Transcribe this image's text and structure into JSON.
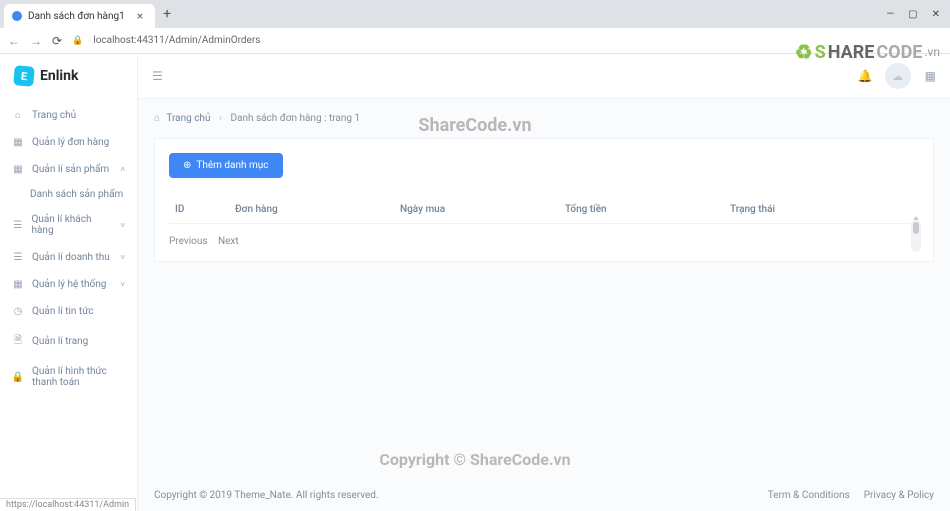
{
  "browser": {
    "tab_title": "Danh sách đơn hàng1",
    "url": "localhost:44311/Admin/AdminOrders",
    "status_link": "https://localhost:44311/Admin"
  },
  "watermarks": {
    "top_brand": "SHARECODE.vn",
    "mid": "ShareCode.vn",
    "bottom": "Copyright © ShareCode.vn"
  },
  "brand": {
    "name": "Enlink",
    "letter": "E"
  },
  "sidebar": {
    "items": [
      {
        "icon": "home",
        "label": "Trang chủ",
        "expandable": false
      },
      {
        "icon": "grid",
        "label": "Quản lý đơn hàng",
        "expandable": false
      },
      {
        "icon": "grid",
        "label": "Quản lí sản phẩm",
        "expandable": true,
        "expanded": true,
        "children": [
          "Danh sách sản phẩm"
        ]
      },
      {
        "icon": "list",
        "label": "Quản lí khách hàng",
        "expandable": true
      },
      {
        "icon": "list",
        "label": "Quản lí doanh thu",
        "expandable": true
      },
      {
        "icon": "grid",
        "label": "Quản lý hệ thống",
        "expandable": true
      },
      {
        "icon": "clock",
        "label": "Quản lí tin tức",
        "expandable": false
      },
      {
        "icon": "file",
        "label": "Quản lí trang",
        "expandable": false
      },
      {
        "icon": "lock",
        "label": "Quản lí hình thức thanh toán",
        "expandable": false
      }
    ]
  },
  "breadcrumb": {
    "home": "Trang chủ",
    "current": "Danh sách đơn hàng : trang 1"
  },
  "actions": {
    "add_category": "Thêm danh mục"
  },
  "table": {
    "columns": [
      "ID",
      "Đơn hàng",
      "Ngày mua",
      "Tổng tiền",
      "Trạng thái"
    ]
  },
  "pagination": {
    "previous": "Previous",
    "next": "Next"
  },
  "footer": {
    "copyright": "Copyright © 2019 Theme_Nate. All rights reserved.",
    "links": [
      "Term & Conditions",
      "Privacy & Policy"
    ]
  }
}
